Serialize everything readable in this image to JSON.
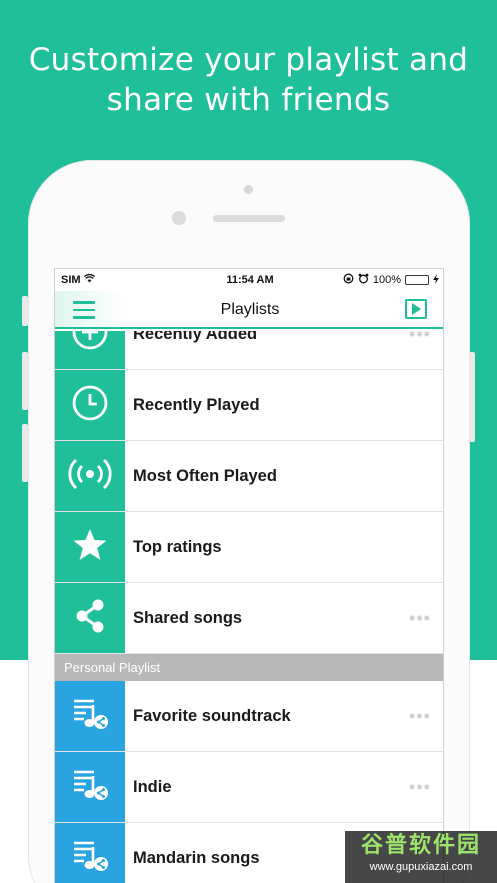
{
  "headline": {
    "line1": "Customize your playlist and",
    "line2": "share with friends"
  },
  "status_bar": {
    "carrier": "SIM",
    "time": "11:54 AM",
    "battery": "100%"
  },
  "navbar": {
    "title": "Playlists"
  },
  "system_playlists": [
    {
      "label": "Recently Added",
      "icon": "plus-circle-icon",
      "more": "•••"
    },
    {
      "label": "Recently Played",
      "icon": "clock-icon",
      "more": ""
    },
    {
      "label": "Most Often Played",
      "icon": "broadcast-icon",
      "more": ""
    },
    {
      "label": "Top ratings",
      "icon": "star-icon",
      "more": ""
    },
    {
      "label": "Shared songs",
      "icon": "share-icon",
      "more": "•••"
    }
  ],
  "section_header": "Personal Playlist",
  "personal_playlists": [
    {
      "label": "Favorite soundtrack",
      "icon": "playlist-share-icon",
      "more": "•••"
    },
    {
      "label": "Indie",
      "icon": "playlist-share-icon",
      "more": "•••"
    },
    {
      "label": "Mandarin songs",
      "icon": "playlist-share-icon",
      "more": ""
    }
  ],
  "watermark": {
    "title": "谷普软件园",
    "url": "www.gupuxiazai.com"
  },
  "colors": {
    "accent": "#1fbf9a",
    "personal": "#2aa4e0",
    "section": "#b8b8b8"
  }
}
